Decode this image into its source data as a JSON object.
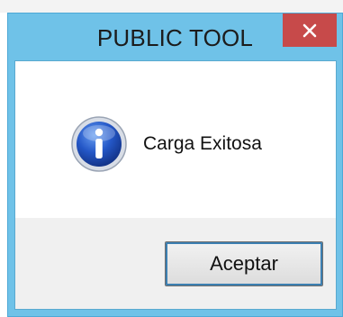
{
  "window": {
    "title": "PUBLIC TOOL",
    "close_icon": "close-icon"
  },
  "dialog": {
    "icon": "info-icon",
    "message": "Carga Exitosa",
    "ok_label": "Aceptar"
  },
  "colors": {
    "frame": "#6fc2e8",
    "close_button": "#c74a4a",
    "footer": "#f0f0f0",
    "icon_blue": "#1f4fb8"
  }
}
